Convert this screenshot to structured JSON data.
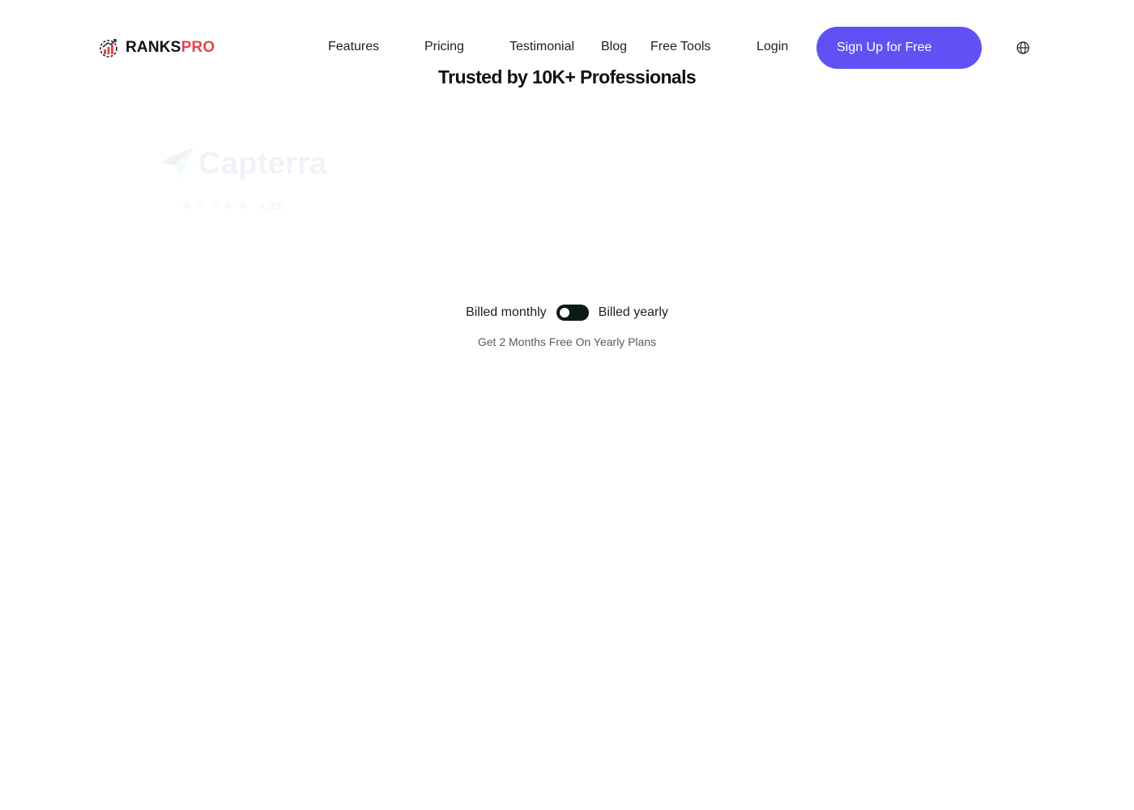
{
  "header": {
    "logo": {
      "part1": "RANKS",
      "part2": "PRO"
    },
    "nav": [
      {
        "label": "Features"
      },
      {
        "label": "Pricing"
      },
      {
        "label": "Testimonial"
      },
      {
        "label": "Blog"
      },
      {
        "label": "Free Tools"
      },
      {
        "label": "Login"
      }
    ],
    "signup_label": "Sign Up for Free",
    "language_icon": "globe-icon"
  },
  "hero": {
    "headline": "Trusted by 10K+ Professionals"
  },
  "reviews": {
    "capterra": {
      "name": "Capterra",
      "stars": "★★★★★",
      "rating": "4.8/5"
    }
  },
  "billing": {
    "monthly_label": "Billed monthly",
    "yearly_label": "Billed yearly",
    "note": "Get 2 Months Free On Yearly Plans"
  },
  "colors": {
    "brand_accent": "#6151f4",
    "logo_red": "#e0474c",
    "toggle_bg": "#0c1a16"
  }
}
